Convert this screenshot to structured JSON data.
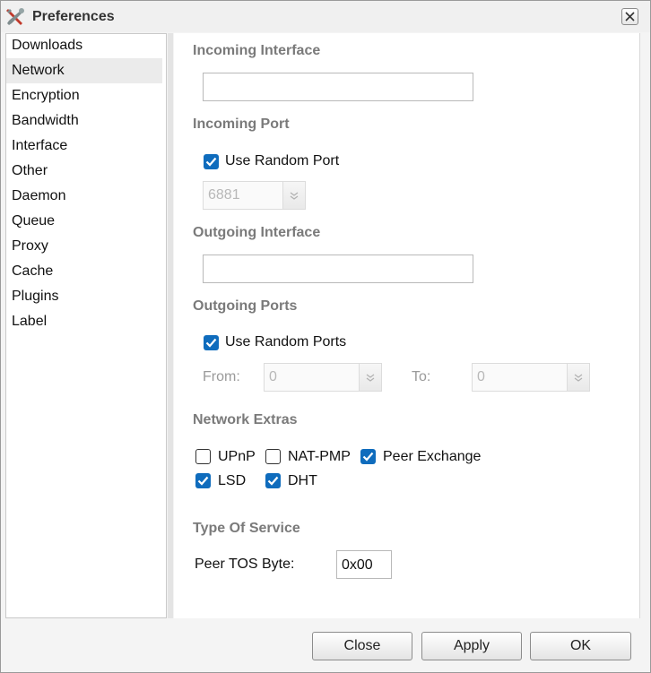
{
  "window": {
    "title": "Preferences",
    "title_icon": "wrench-screwdriver-icon",
    "close_icon": "close-icon"
  },
  "sidebar": {
    "items": [
      {
        "label": "Downloads",
        "selected": false
      },
      {
        "label": "Network",
        "selected": true
      },
      {
        "label": "Encryption",
        "selected": false
      },
      {
        "label": "Bandwidth",
        "selected": false
      },
      {
        "label": "Interface",
        "selected": false
      },
      {
        "label": "Other",
        "selected": false
      },
      {
        "label": "Daemon",
        "selected": false
      },
      {
        "label": "Queue",
        "selected": false
      },
      {
        "label": "Proxy",
        "selected": false
      },
      {
        "label": "Cache",
        "selected": false
      },
      {
        "label": "Plugins",
        "selected": false
      },
      {
        "label": "Label",
        "selected": false
      }
    ]
  },
  "network": {
    "incoming_interface": {
      "heading": "Incoming Interface",
      "value": ""
    },
    "incoming_port": {
      "heading": "Incoming Port",
      "random_label": "Use Random Port",
      "random_checked": true,
      "port_value": "6881"
    },
    "outgoing_interface": {
      "heading": "Outgoing Interface",
      "value": ""
    },
    "outgoing_ports": {
      "heading": "Outgoing Ports",
      "random_label": "Use Random Ports",
      "random_checked": true,
      "from_label": "From:",
      "from_value": "0",
      "to_label": "To:",
      "to_value": "0"
    },
    "extras": {
      "heading": "Network Extras",
      "upnp": {
        "label": "UPnP",
        "checked": false
      },
      "natpmp": {
        "label": "NAT-PMP",
        "checked": false
      },
      "pex": {
        "label": "Peer Exchange",
        "checked": true
      },
      "lsd": {
        "label": "LSD",
        "checked": true
      },
      "dht": {
        "label": "DHT",
        "checked": true
      }
    },
    "tos": {
      "heading": "Type Of Service",
      "label": "Peer TOS Byte:",
      "value": "0x00"
    }
  },
  "footer": {
    "close_label": "Close",
    "apply_label": "Apply",
    "ok_label": "OK"
  },
  "colors": {
    "checkbox_on": "#0f6cbd",
    "section_heading": "#7a7a7a"
  }
}
